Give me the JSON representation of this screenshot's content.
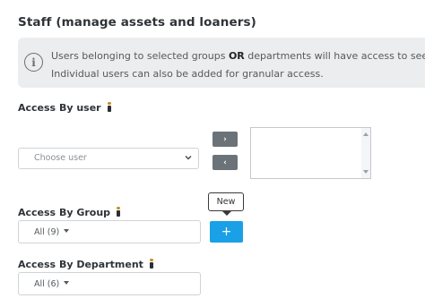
{
  "section": {
    "title": "Staff (manage assets and loaners)"
  },
  "info": {
    "line1_before": "Users belonging to selected groups ",
    "line1_bold": "OR",
    "line1_after": " departments will have access to see a",
    "line2": "Individual users can also be added for granular access.",
    "icon": "info-circle-icon"
  },
  "access_user": {
    "label": "Access By user",
    "select_placeholder": "Choose user",
    "add_arrow": "›",
    "remove_arrow": "‹"
  },
  "access_group": {
    "label": "Access By Group",
    "value": "All (9)",
    "tooltip": "New",
    "add_button": "+"
  },
  "access_department": {
    "label": "Access By Department",
    "value": "All (6)"
  },
  "colors": {
    "accent": "#1aa0e6",
    "arrow_button": "#6c7378",
    "info_background": "#ebedef"
  }
}
